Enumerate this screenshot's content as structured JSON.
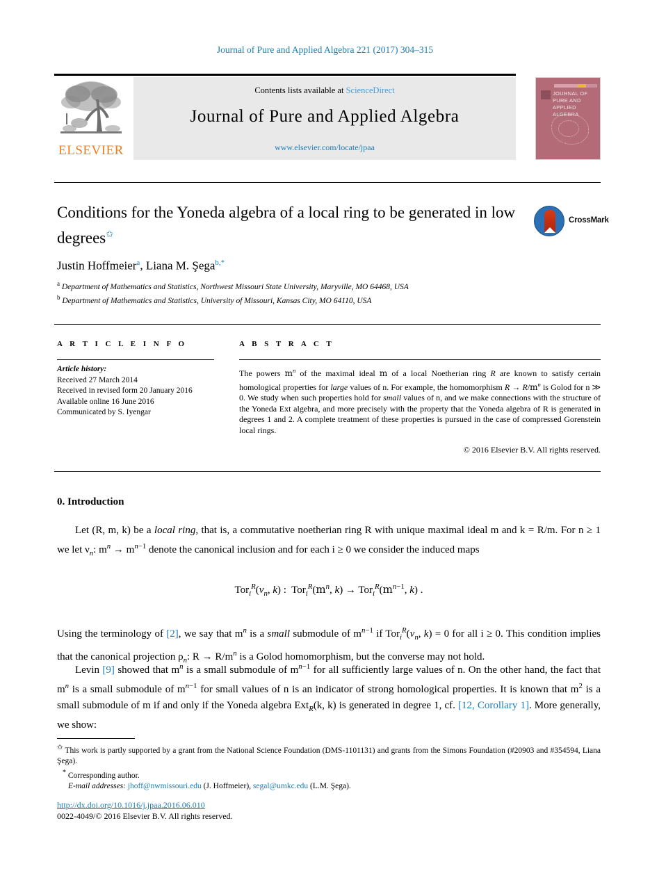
{
  "running_head": "Journal of Pure and Applied Algebra 221 (2017) 304–315",
  "masthead": {
    "contents_prefix": "Contents lists available at ",
    "sciencedirect": "ScienceDirect",
    "journal_title": "Journal of Pure and Applied Algebra",
    "journal_url": "www.elsevier.com/locate/jpaa",
    "publisher_wordmark": "ELSEVIER",
    "cover_title": "JOURNAL OF PURE AND APPLIED ALGEBRA"
  },
  "article": {
    "title": "Conditions for the Yoneda algebra of a local ring to be generated in low degrees",
    "title_footnote_mark": "✩",
    "authors": "Justin Hoffmeier",
    "author_1": "Justin Hoffmeier",
    "author_1_mark": "a",
    "author_2": "Liana M. Şega",
    "author_2_mark": "b,*",
    "affiliation_a_mark": "a",
    "affiliation_a": "Department of Mathematics and Statistics, Northwest Missouri State University, Maryville, MO 64468, USA",
    "affiliation_b_mark": "b",
    "affiliation_b": "Department of Mathematics and Statistics, University of Missouri, Kansas City, MO 64110, USA",
    "crossmark_label": "CrossMark"
  },
  "info": {
    "heading": "A R T I C L E   I N F O",
    "history_label": "Article history:",
    "received": "Received 27 March 2014",
    "revised": "Received in revised form 20 January 2016",
    "available": "Available online 16 June 2016",
    "communicated": "Communicated by S. Iyengar"
  },
  "abstract": {
    "heading": "A B S T R A C T",
    "text_part_1": "The powers ",
    "text_part_2": " of the maximal ideal ",
    "text_part_3": " of a local Noetherian ring ",
    "text_part_4": " are known to satisfy certain homological properties for ",
    "emph_large": "large",
    "text_part_5": " values of n. For example, the homomorphism ",
    "text_part_6": " is Golod for n ≫ 0. We study when such properties hold for ",
    "emph_small": "small",
    "text_part_7": " values of n, and we make connections with the structure of the Yoneda Ext algebra, and more precisely with the property that the Yoneda algebra of R is generated in degrees 1 and 2. A complete treatment of these properties is pursued in the case of compressed Gorenstein local rings.",
    "copyright": "© 2016 Elsevier B.V. All rights reserved."
  },
  "body": {
    "section_title": "0. Introduction",
    "para_1_a": "Let (R, m, k) be a ",
    "para_1_emph": "local ring",
    "para_1_b": ", that is, a commutative noetherian ring R with unique maximal ideal m and k = R/m. For n ≥ 1 we let ν",
    "para_1_c": ": m",
    "para_1_d": " → m",
    "para_1_e": " denote the canonical inclusion and for each i ≥ 0 we consider the induced maps",
    "equation": "Tor",
    "equation_full": "Tor_i^R(ν_n, k) :  Tor_i^R(m^n, k) → Tor_i^R(m^(n−1), k) .",
    "para_2_a": "Using the terminology of ",
    "para_2_ref": "[2]",
    "para_2_b": ", we say that m",
    "para_2_emph": "small",
    "para_2_c": " submodule of m",
    "para_2_d": " if Tor",
    "para_2_e": " = 0 for all i ≥ 0. This condition implies that the canonical projection ρ",
    "para_2_f": ": R → R/m",
    "para_2_g": " is a Golod homomorphism, but the converse may not hold.",
    "para_3_a": "Levin ",
    "para_3_ref_1": "[9]",
    "para_3_b": " showed that m",
    "para_3_c": " is a small submodule of m",
    "para_3_d": " for all sufficiently large values of n. On the other hand, the fact that m",
    "para_3_e": " is a small submodule of m",
    "para_3_f": " for small values of n is an indicator of strong homological properties. It is known that m",
    "para_3_g": " is a small submodule of m if and only if the Yoneda algebra Ext",
    "para_3_h": "(k, k) is generated in degree 1, cf. ",
    "para_3_ref_2": "[12, Corollary 1]",
    "para_3_i": ". More generally, we show:"
  },
  "footnotes": {
    "fn1_mark": "✩",
    "fn1": "This work is partly supported by a grant from the National Science Foundation (DMS-1101131) and grants from the Simons Foundation (#20903 and #354594, Liana Şega).",
    "fn2_mark": "*",
    "fn2": "Corresponding author.",
    "email_label": "E-mail addresses:",
    "email_1": "jhoff@nwmissouri.edu",
    "email_1_owner": "(J. Hoffmeier),",
    "email_2": "segal@umkc.edu",
    "email_2_owner": "(L.M. Şega)."
  },
  "footer": {
    "doi": "http://dx.doi.org/10.1016/j.jpaa.2016.06.010",
    "issn_line": "0022-4049/© 2016 Elsevier B.V. All rights reserved."
  },
  "colors": {
    "link_blue": "#1a7db6",
    "elsevier_orange": "#f07d1a",
    "cover_mauve": "#b36b78",
    "band_gray": "#e9e9e9"
  }
}
